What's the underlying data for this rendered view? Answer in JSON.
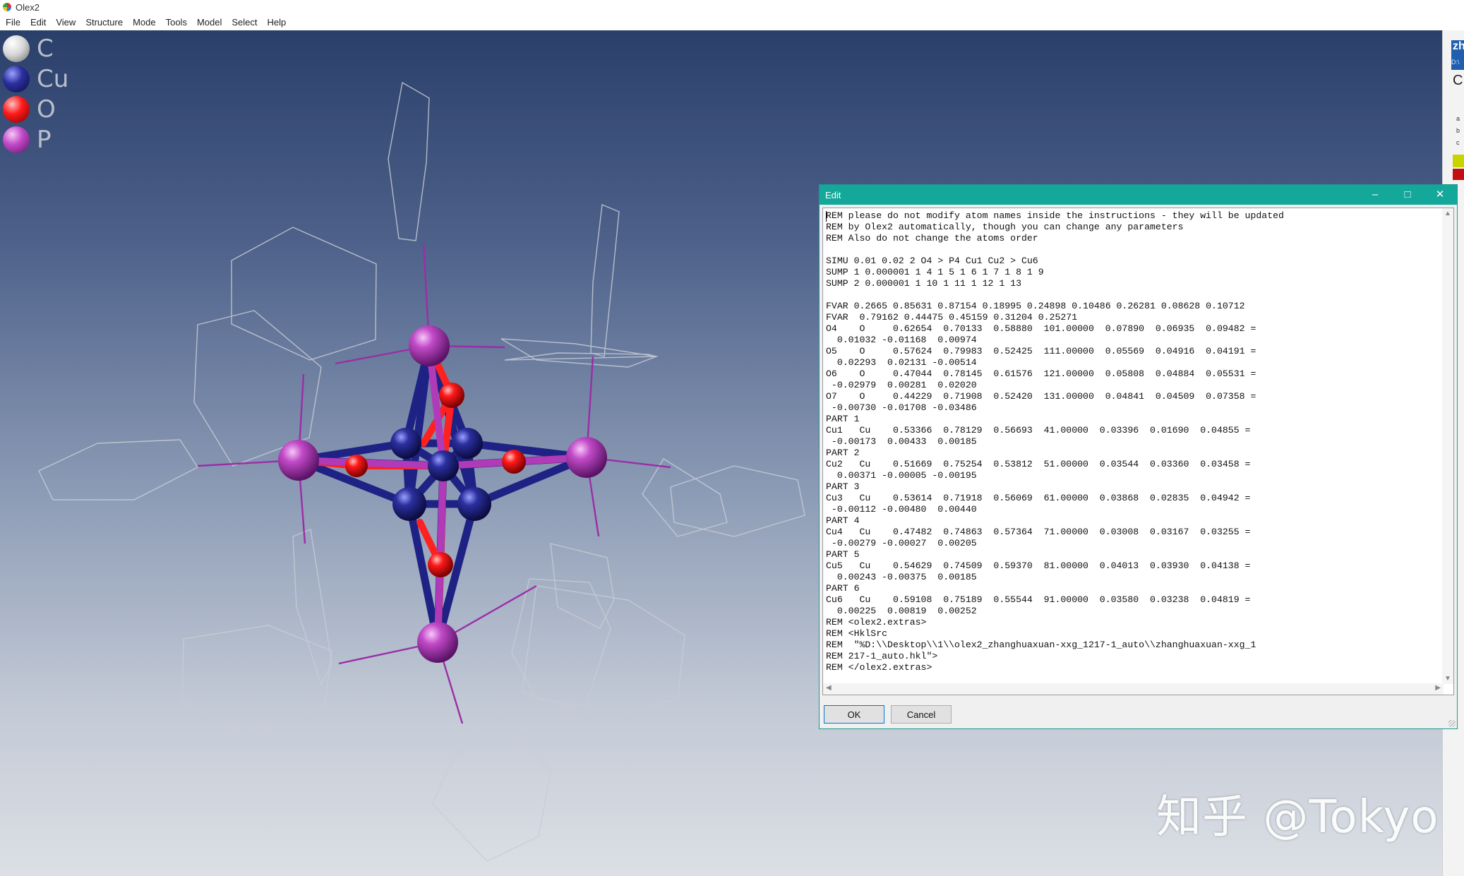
{
  "window": {
    "title": "Olex2"
  },
  "menu": [
    "File",
    "Edit",
    "View",
    "Structure",
    "Mode",
    "Tools",
    "Model",
    "Select",
    "Help"
  ],
  "legend": [
    {
      "label": "C",
      "color": "#e6e6e6"
    },
    {
      "label": "Cu",
      "color": "#2b2f9e"
    },
    {
      "label": "O",
      "color": "#ff1a1a"
    },
    {
      "label": "P",
      "color": "#b03ab8"
    }
  ],
  "side_panel": {
    "header": "zh",
    "path": "D:\\",
    "formula": "C",
    "cell_lines": [
      "a",
      "b",
      "c"
    ]
  },
  "dialog": {
    "title": "Edit",
    "minimize_icon": "minimize-icon",
    "maximize_icon": "maximize-icon",
    "close_icon": "close-icon",
    "text": "REM please do not modify atom names inside the instructions - they will be updated\nREM by Olex2 automatically, though you can change any parameters\nREM Also do not change the atoms order\n\nSIMU 0.01 0.02 2 O4 > P4 Cu1 Cu2 > Cu6\nSUMP 1 0.000001 1 4 1 5 1 6 1 7 1 8 1 9\nSUMP 2 0.000001 1 10 1 11 1 12 1 13\n\nFVAR 0.2665 0.85631 0.87154 0.18995 0.24898 0.10486 0.26281 0.08628 0.10712\nFVAR  0.79162 0.44475 0.45159 0.31204 0.25271\nO4    O     0.62654  0.70133  0.58880  101.00000  0.07890  0.06935  0.09482 =\n  0.01032 -0.01168  0.00974\nO5    O     0.57624  0.79983  0.52425  111.00000  0.05569  0.04916  0.04191 =\n  0.02293  0.02131 -0.00514\nO6    O     0.47044  0.78145  0.61576  121.00000  0.05808  0.04884  0.05531 =\n -0.02979  0.00281  0.02020\nO7    O     0.44229  0.71908  0.52420  131.00000  0.04841  0.04509  0.07358 =\n -0.00730 -0.01708 -0.03486\nPART 1\nCu1   Cu    0.53366  0.78129  0.56693  41.00000  0.03396  0.01690  0.04855 =\n -0.00173  0.00433  0.00185\nPART 2\nCu2   Cu    0.51669  0.75254  0.53812  51.00000  0.03544  0.03360  0.03458 =\n  0.00371 -0.00005 -0.00195\nPART 3\nCu3   Cu    0.53614  0.71918  0.56069  61.00000  0.03868  0.02835  0.04942 =\n -0.00112 -0.00480  0.00440\nPART 4\nCu4   Cu    0.47482  0.74863  0.57364  71.00000  0.03008  0.03167  0.03255 =\n -0.00279 -0.00027  0.00205\nPART 5\nCu5   Cu    0.54629  0.74509  0.59370  81.00000  0.04013  0.03930  0.04138 =\n  0.00243 -0.00375  0.00185\nPART 6\nCu6   Cu    0.59108  0.75189  0.55544  91.00000  0.03580  0.03238  0.04819 =\n  0.00225  0.00819  0.00252\nREM <olex2.extras>\nREM <HklSrc\nREM  \"%D:\\\\Desktop\\\\1\\\\olex2_zhanghuaxuan-xxg_1217-1_auto\\\\zhanghuaxuan-xxg_1\nREM 217-1_auto.hkl\">\nREM </olex2.extras>",
    "ok_label": "OK",
    "cancel_label": "Cancel"
  },
  "watermark": "知乎 @Tokyo"
}
